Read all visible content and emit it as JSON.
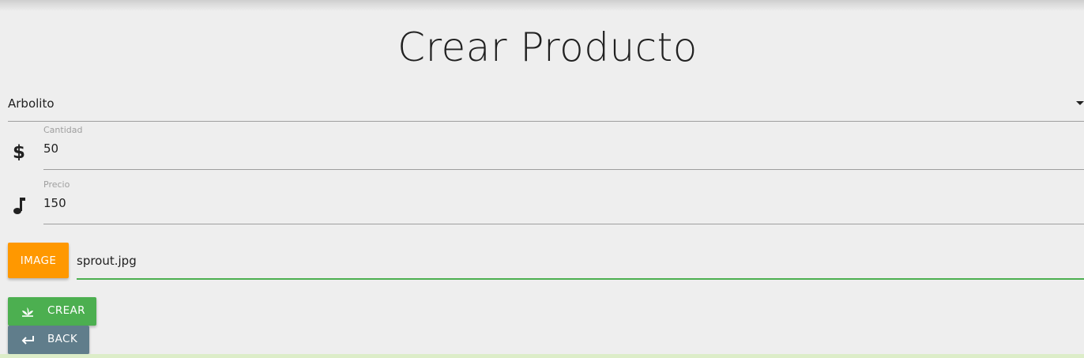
{
  "page": {
    "title": "Crear Producto"
  },
  "form": {
    "product_select": {
      "value": "Arbolito"
    },
    "cantidad": {
      "label": "Cantidad",
      "value": "50",
      "icon": "dollar-icon"
    },
    "precio": {
      "label": "Precio",
      "value": "150",
      "icon": "music-note-icon"
    },
    "image": {
      "button_label": "IMAGE",
      "file_name": "sprout.jpg"
    }
  },
  "actions": {
    "crear_label": "CREAR",
    "crear_icon": "sprout-icon",
    "back_label": "BACK",
    "back_icon": "back-arrow-icon"
  },
  "colors": {
    "background": "#eeeeee",
    "image_button": "#ff9800",
    "crear_button": "#4caf50",
    "back_button": "#607d8b",
    "active_underline": "#4caf50"
  }
}
